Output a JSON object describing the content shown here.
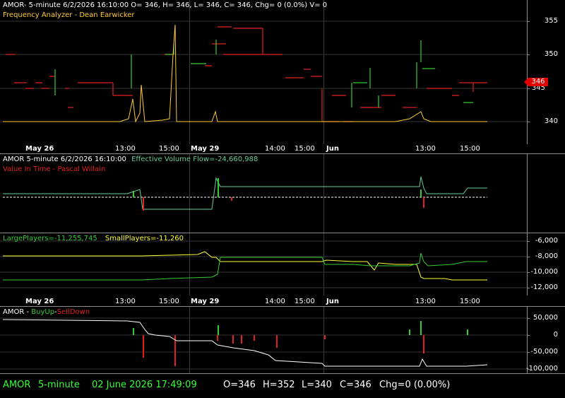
{
  "pane1": {
    "header": "AMOR- 5-minute 6/2/2026 16:10:00 O= 346, H= 346, L= 346, C= 346, Chg= 0 (0.0%) V= 0",
    "indicator": "Frequency Analyzer - Dean Earwicker",
    "axis_labels": [
      "355",
      "350",
      "345",
      "340"
    ],
    "last_price": "346",
    "colors": {
      "up": "#33cc33",
      "down": "#e02020",
      "indicator": "#ffcc33"
    }
  },
  "time_axis_1": {
    "labels": [
      "May 26",
      "13:00",
      "15:00",
      "May 29",
      "14:00",
      "15:00",
      "Jun",
      "13:00",
      "15:00"
    ]
  },
  "pane2": {
    "header": "AMOR 5-minute  6/2/2026 16:10:00",
    "indicator1": "Effective Volume Flow=-24,660,988",
    "indicator2": "Value In Time - Pascal Willain",
    "colors": {
      "flow": "#66cc99",
      "vit": "#e02020"
    }
  },
  "pane3": {
    "large_players": "LargePlayers=-11,255,745",
    "small_players": "SmallPlayers=-11,260",
    "axis_labels": [
      "-6,000",
      "-8,000",
      "-10,000",
      "-12,000"
    ],
    "colors": {
      "large": "#33cc33",
      "small": "#ffff33"
    }
  },
  "time_axis_2": {
    "labels": [
      "May 26",
      "13:00",
      "15:00",
      "May 29",
      "14:00",
      "15:00",
      "Jun",
      "13:00",
      "15:00"
    ]
  },
  "pane4": {
    "symbol": "AMOR - ",
    "buyup": "BuyUp",
    "dash": "-",
    "selldown": "SellDown",
    "axis_labels": [
      "50,000",
      "0",
      "-50,000",
      "-100,000"
    ],
    "colors": {
      "buy": "#33cc33",
      "sell": "#e02020",
      "line": "#ffffff"
    }
  },
  "status_bar": {
    "symbol": "AMOR",
    "interval": "5-minute",
    "datetime": "02 June 2026 17:49:09",
    "open": "O=346",
    "high": "H=352",
    "low": "L=340",
    "close": "C=346",
    "change": "Chg=0 (0.00%)"
  }
}
